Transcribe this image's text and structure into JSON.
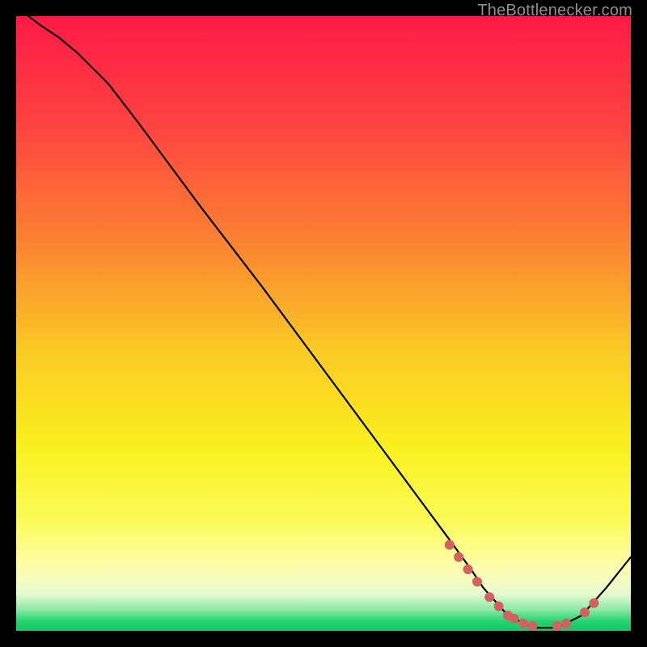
{
  "watermark": "TheBottlenecker.com",
  "colors": {
    "curve": "#000000",
    "marker": "#d46060",
    "axis_black": "#000000"
  },
  "chart_data": {
    "type": "line",
    "title": "",
    "xlabel": "",
    "ylabel": "",
    "xlim": [
      0,
      100
    ],
    "ylim": [
      0,
      100
    ],
    "grid": false,
    "legend": false,
    "background_gradient_stops": [
      {
        "offset": 0.0,
        "color": "#fe1a47"
      },
      {
        "offset": 0.18,
        "color": "#fd4440"
      },
      {
        "offset": 0.36,
        "color": "#fb8032"
      },
      {
        "offset": 0.54,
        "color": "#fac825"
      },
      {
        "offset": 0.7,
        "color": "#f9f01d"
      },
      {
        "offset": 0.82,
        "color": "#fbfb58"
      },
      {
        "offset": 0.9,
        "color": "#fdfdb0"
      },
      {
        "offset": 0.94,
        "color": "#e7fad0"
      },
      {
        "offset": 0.965,
        "color": "#8de9a7"
      },
      {
        "offset": 0.985,
        "color": "#22d36e"
      },
      {
        "offset": 1.0,
        "color": "#11c964"
      }
    ],
    "series": [
      {
        "name": "bottleneck-curve",
        "x": [
          2,
          4,
          7,
          10,
          15,
          20,
          30,
          40,
          50,
          60,
          70,
          74,
          76,
          80,
          84,
          88,
          92,
          96,
          100
        ],
        "y": [
          100,
          98.5,
          96.5,
          94,
          89,
          82.5,
          69,
          56,
          42.5,
          29,
          15.5,
          10,
          7,
          2.5,
          0.5,
          0.5,
          2.5,
          7,
          12
        ]
      }
    ],
    "markers": {
      "name": "highlight-points",
      "x": [
        70.5,
        72,
        73.5,
        75,
        77,
        78.5,
        80,
        81,
        82.5,
        84,
        88,
        89.5,
        92.5,
        94
      ],
      "y": [
        14,
        12,
        10,
        8,
        5.5,
        4,
        2.5,
        2,
        1.2,
        0.8,
        0.8,
        1.2,
        3,
        4.5
      ]
    }
  }
}
